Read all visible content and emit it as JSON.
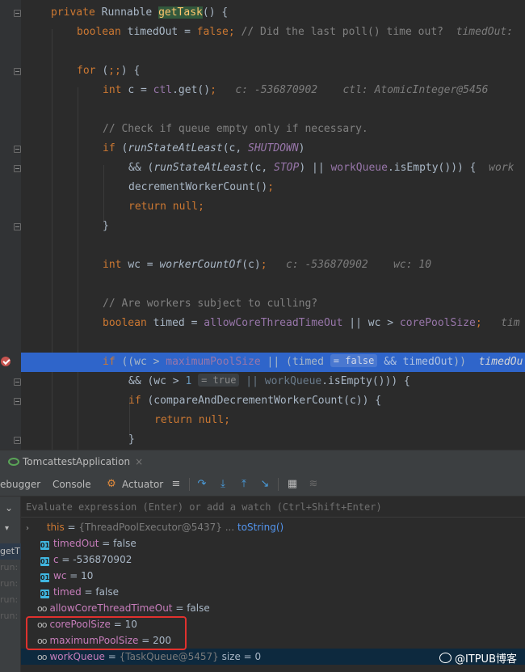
{
  "code": {
    "l1": {
      "a": "private ",
      "b": "Runnable ",
      "c": "getTask",
      "d": "() {"
    },
    "l2": {
      "a": "boolean ",
      "b": "timedOut = ",
      "c": "false",
      "d": "; ",
      "e": "// Did the last poll() time out?",
      "h": "timedOut:"
    },
    "l4": {
      "a": "for ",
      "b": "(",
      "c": ";;",
      "d": ") {"
    },
    "l5": {
      "a": "int ",
      "b": "c = ",
      "c": "ctl",
      "d": ".get()",
      "e": ";",
      "h1": "c: -536870902",
      "h2": "ctl: AtomicInteger@5456"
    },
    "l7": {
      "a": "// Check if queue empty only if necessary."
    },
    "l8": {
      "a": "if ",
      "b": "(",
      "c": "runStateAtLeast",
      "d": "(c, ",
      "e": "SHUTDOWN",
      "f": ")"
    },
    "l9": {
      "a": "&& (",
      "b": "runStateAtLeast",
      "c": "(c, ",
      "d": "STOP",
      "e": ") || ",
      "f": "workQueue",
      "g": ".isEmpty())) {",
      "h": "work"
    },
    "l10": {
      "a": "decrementWorkerCount",
      "b": "()",
      "c": ";"
    },
    "l11": {
      "a": "return null",
      "b": ";"
    },
    "l12": {
      "a": "}"
    },
    "l14": {
      "a": "int ",
      "b": "wc = ",
      "c": "workerCountOf",
      "d": "(c)",
      "e": ";",
      "h1": "c: -536870902",
      "h2": "wc: 10"
    },
    "l16": {
      "a": "// Are workers subject to culling?"
    },
    "l17": {
      "a": "boolean ",
      "b": "timed = ",
      "c": "allowCoreThreadTimeOut",
      "d": " || wc > ",
      "e": "corePoolSize",
      "f": ";",
      "h": "tim"
    },
    "l19": {
      "a": "if ",
      "b": "((wc > ",
      "c": "maximumPoolSize",
      "d": " || (timed",
      "chip": "= false",
      "e": " && timedOut",
      "f": "))",
      "h": "timedOu"
    },
    "l20": {
      "a": "&& (wc > ",
      "b": "1",
      "chip": "= true",
      "c": " || ",
      "d": "workQueue",
      "e": ".isEmpty())) {"
    },
    "l21": {
      "a": "if ",
      "b": "(compareAndDecrementWorkerCount(c)) {"
    },
    "l22": {
      "a": "return null",
      "b": ";"
    },
    "l23": {
      "a": "}"
    }
  },
  "run_tab": {
    "label": "TomcattestApplication",
    "close": "×"
  },
  "toolbar": {
    "debugger": "ebugger",
    "console": "Console",
    "actuator": "Actuator"
  },
  "eval": {
    "placeholder": "Evaluate expression (Enter) or add a watch (Ctrl+Shift+Enter)"
  },
  "frames": [
    "getT",
    "run:",
    "run:",
    "run:",
    "run:"
  ],
  "vars": {
    "this": {
      "name": "this",
      "eq": " = ",
      "val": "{ThreadPoolExecutor@5437}",
      "extra": " ... ",
      "link": "toString()"
    },
    "timedOut": {
      "name": "timedOut",
      "eq": " = ",
      "val": "false"
    },
    "c": {
      "name": "c",
      "eq": " = ",
      "val": "-536870902"
    },
    "wc": {
      "name": "wc",
      "eq": " = ",
      "val": "10"
    },
    "timed": {
      "name": "timed",
      "eq": " = ",
      "val": "false"
    },
    "allowCoreThreadTimeOut": {
      "name": "allowCoreThreadTimeOut",
      "eq": " = ",
      "val": "false"
    },
    "corePoolSize": {
      "name": "corePoolSize",
      "eq": " = ",
      "val": "10"
    },
    "maximumPoolSize": {
      "name": "maximumPoolSize",
      "eq": " = ",
      "val": "200"
    },
    "workQueue": {
      "name": "workQueue",
      "eq": " = ",
      "val": "{TaskQueue@5457}",
      "extra": "  size = 0"
    }
  },
  "watermark": "@ITPUB博客"
}
